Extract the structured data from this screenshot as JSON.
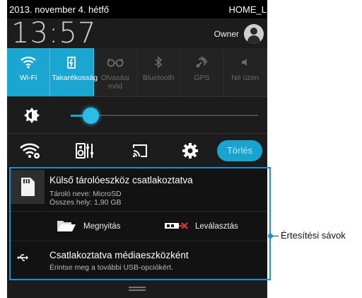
{
  "status_bar": {
    "date": "2013. november 4. hétfő",
    "network": "HOME_LIN"
  },
  "clock": {
    "time": "13:57",
    "user": "Owner"
  },
  "quick_toggles": [
    {
      "label": "Wi-Fi",
      "active": true,
      "icon": "wifi-icon"
    },
    {
      "label": "Takarékosság",
      "active": true,
      "icon": "power-saver-icon"
    },
    {
      "label": "Olvasási mód",
      "active": false,
      "icon": "reading-glasses-icon"
    },
    {
      "label": "Bluetooth",
      "active": false,
      "icon": "bluetooth-icon"
    },
    {
      "label": "GPS",
      "active": false,
      "icon": "gps-icon"
    },
    {
      "label": "Né üzen",
      "active": false,
      "icon": "speaker-icon"
    }
  ],
  "brightness": {
    "level_fraction": 0.12
  },
  "actions": {
    "clear_label": "Törlés"
  },
  "notifications": [
    {
      "title": "Külső tárolóeszköz csatlakoztatva",
      "line1": "Tároló neve: MicroSD",
      "line2": "Összes hely: 1,90 GB",
      "open_label": "Megnyitás",
      "unmount_label": "Leválasztás"
    },
    {
      "title": "Csatlakoztatva médiaeszközként",
      "subtitle": "Érintse meg a további USB-opciókért."
    }
  ],
  "annotation": {
    "label": "Értesítési sávok"
  },
  "colors": {
    "accent": "#1aa6d1",
    "highlight_border": "#1a8fd6",
    "panel_bg": "#1c1c1c"
  }
}
